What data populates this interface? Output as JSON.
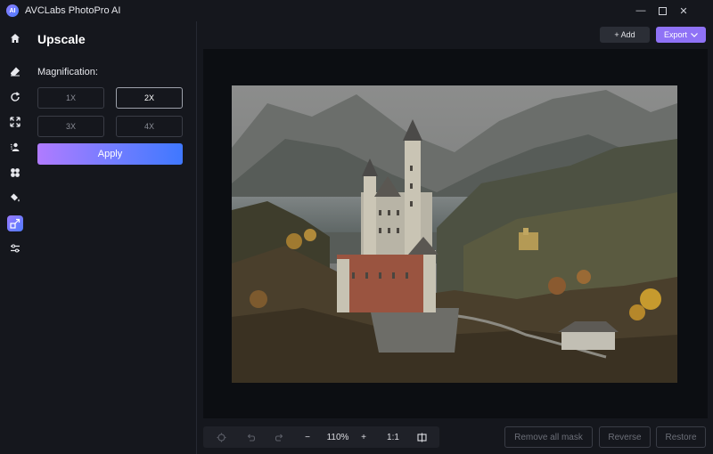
{
  "app": {
    "title": "AVCLabs PhotoPro AI",
    "logo_text": "AI"
  },
  "window": {
    "minimize": "—",
    "maximize": "☐",
    "close": "✕"
  },
  "rail": {
    "items": [
      {
        "name": "home",
        "icon": "home-icon"
      },
      {
        "name": "erase",
        "icon": "eraser-icon"
      },
      {
        "name": "replace",
        "icon": "refresh-icon"
      },
      {
        "name": "enhance",
        "icon": "expand-icon"
      },
      {
        "name": "remove-background",
        "icon": "person-icon"
      },
      {
        "name": "colorize",
        "icon": "pinwheel-icon"
      },
      {
        "name": "paint",
        "icon": "paint-bucket-icon"
      },
      {
        "name": "upscale",
        "icon": "upscale-icon",
        "active": true
      },
      {
        "name": "adjust",
        "icon": "sliders-icon"
      }
    ]
  },
  "panel": {
    "title": "Upscale",
    "magnification_label": "Magnification:",
    "options": [
      "1X",
      "2X",
      "3X",
      "4X"
    ],
    "selected": "2X",
    "apply_label": "Apply"
  },
  "header": {
    "add_label": "+ Add",
    "export_label": "Export"
  },
  "zoom": {
    "level": "110%",
    "one_to_one": "1:1",
    "minus": "−",
    "plus": "+"
  },
  "actions": {
    "remove_all_mask": "Remove all mask",
    "reverse": "Reverse",
    "restore": "Restore"
  },
  "colors": {
    "accent": "#8f72f6",
    "apply_gradient_start": "#b07bff",
    "apply_gradient_end": "#3f78ff",
    "background": "#15171d",
    "canvas": "#0c0e12"
  }
}
